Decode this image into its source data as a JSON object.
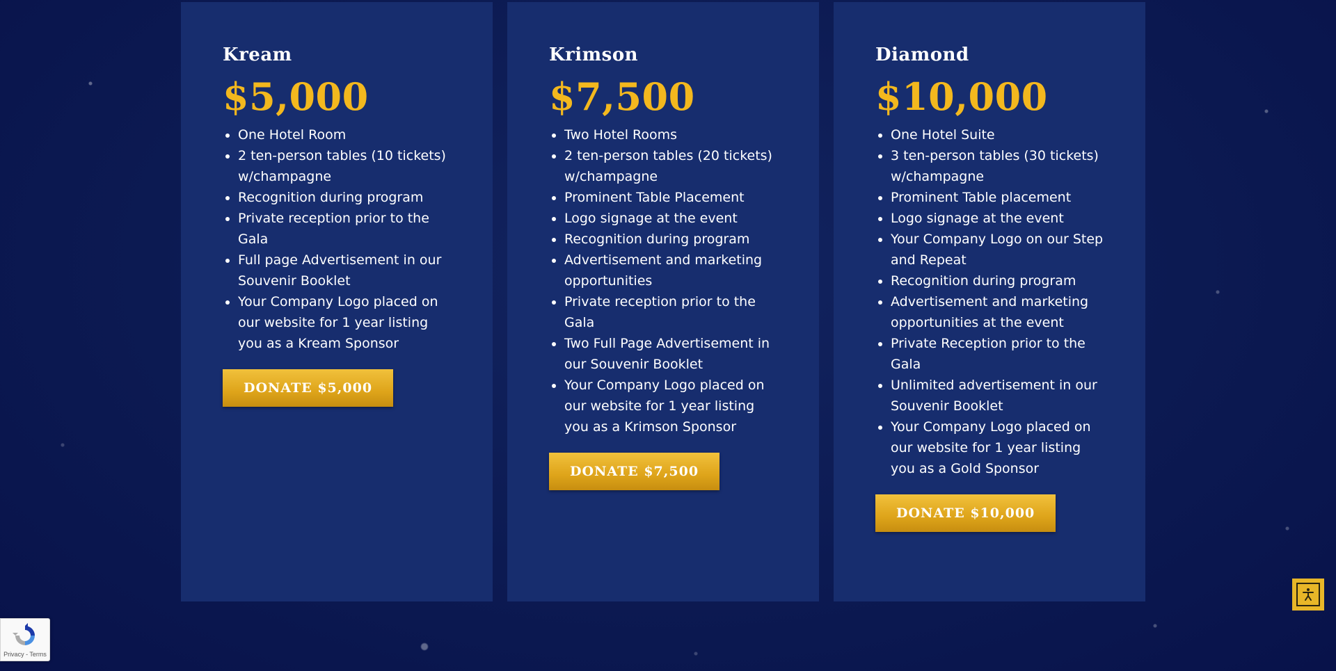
{
  "tiers": [
    {
      "name": "Kream",
      "price": "$5,000",
      "perks": [
        "One Hotel Room",
        "2 ten-person tables (10 tickets) w/champagne",
        "Recognition during program",
        "Private reception prior to the Gala",
        "Full page Advertisement in our Souvenir Booklet",
        "Your Company Logo placed on our website for 1 year listing you as a Kream Sponsor"
      ],
      "button_label": "DONATE $5,000"
    },
    {
      "name": "Krimson",
      "price": "$7,500",
      "perks": [
        "Two Hotel Rooms",
        "2 ten-person tables (20 tickets) w/champagne",
        "Prominent Table Placement",
        "Logo signage at the event",
        "Recognition during program",
        "Advertisement and marketing opportunities",
        "Private reception prior to the Gala",
        "Two Full Page Advertisement in our Souvenir Booklet",
        "Your Company Logo placed on our website for 1 year listing you as a Krimson Sponsor"
      ],
      "button_label": "DONATE $7,500"
    },
    {
      "name": "Diamond",
      "price": "$10,000",
      "perks": [
        "One Hotel Suite",
        "3 ten-person tables (30 tickets) w/champagne",
        "Prominent Table placement",
        "Logo signage at the event",
        "Your Company Logo on our Step and Repeat",
        "Recognition during program",
        "Advertisement and marketing opportunities at the event",
        "Private Reception prior to the Gala",
        "Unlimited advertisement in our Souvenir Booklet",
        "Your Company Logo placed on our website for 1 year listing you as a Gold Sponsor"
      ],
      "button_label": "DONATE $10,000"
    }
  ],
  "recaptcha": {
    "privacy_label": "Privacy",
    "separator": " - ",
    "terms_label": "Terms",
    "icon": "recaptcha-icon"
  },
  "accessibility": {
    "icon": "accessibility-icon"
  },
  "colors": {
    "background": "#0c1a52",
    "card": "#172d6e",
    "price": "#f3b81e",
    "button": "#dea41a",
    "text": "#ffffff"
  }
}
